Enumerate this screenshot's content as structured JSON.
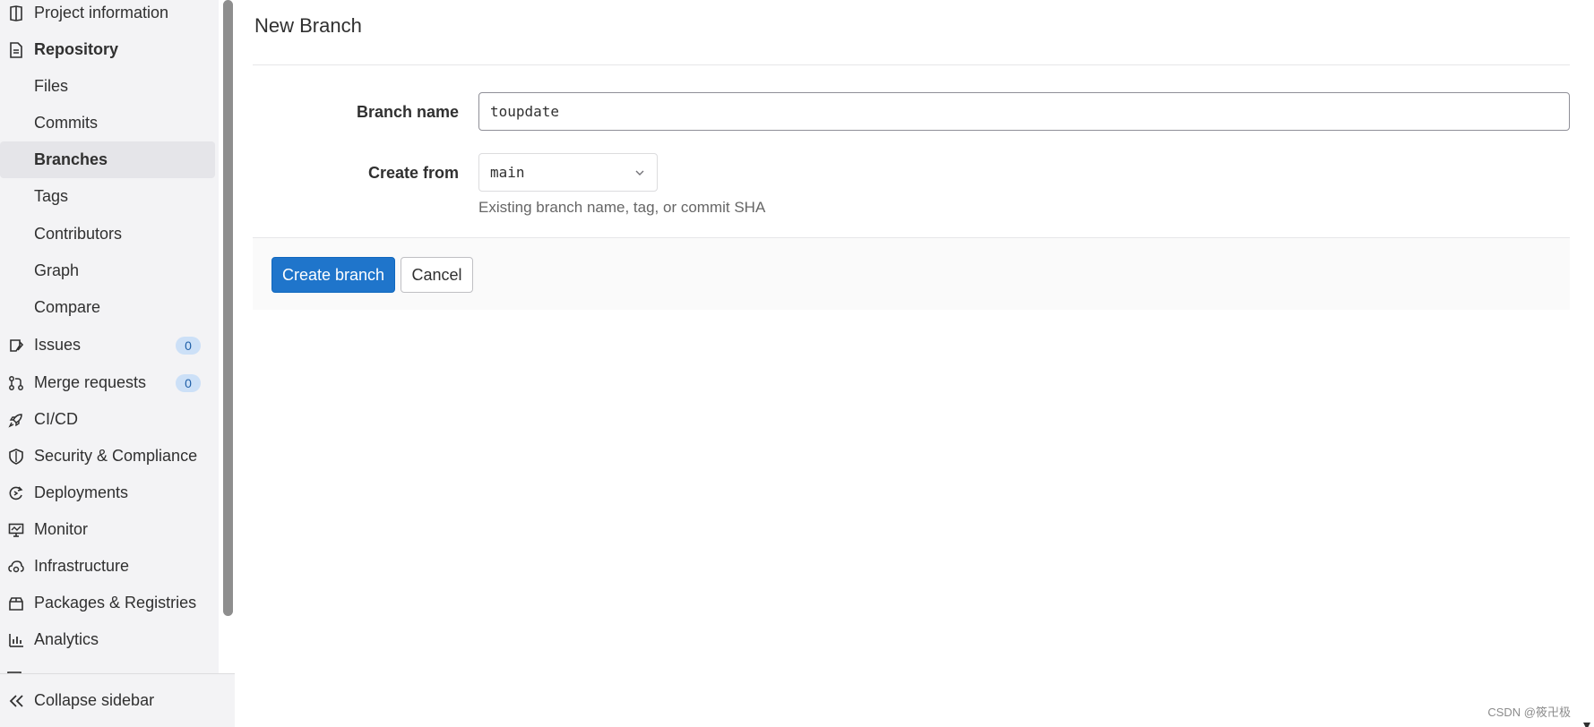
{
  "sidebar": {
    "items": [
      {
        "label": "Project information",
        "kind": "section-plain",
        "icon": "info-icon"
      },
      {
        "label": "Repository",
        "kind": "section",
        "icon": "document-icon"
      },
      {
        "label": "Files",
        "kind": "sub"
      },
      {
        "label": "Commits",
        "kind": "sub"
      },
      {
        "label": "Branches",
        "kind": "sub-active"
      },
      {
        "label": "Tags",
        "kind": "sub"
      },
      {
        "label": "Contributors",
        "kind": "sub"
      },
      {
        "label": "Graph",
        "kind": "sub"
      },
      {
        "label": "Compare",
        "kind": "sub"
      },
      {
        "label": "Issues",
        "kind": "top",
        "icon": "issues-icon",
        "badge": "0"
      },
      {
        "label": "Merge requests",
        "kind": "top",
        "icon": "merge-request-icon",
        "badge": "0"
      },
      {
        "label": "CI/CD",
        "kind": "top",
        "icon": "rocket-icon"
      },
      {
        "label": "Security & Compliance",
        "kind": "top",
        "icon": "shield-icon"
      },
      {
        "label": "Deployments",
        "kind": "top",
        "icon": "deployments-icon"
      },
      {
        "label": "Monitor",
        "kind": "top",
        "icon": "monitor-icon"
      },
      {
        "label": "Infrastructure",
        "kind": "top",
        "icon": "cloud-gear-icon"
      },
      {
        "label": "Packages & Registries",
        "kind": "top",
        "icon": "package-icon"
      },
      {
        "label": "Analytics",
        "kind": "top",
        "icon": "chart-icon"
      }
    ],
    "collapse_label": "Collapse sidebar"
  },
  "main": {
    "title": "New Branch",
    "branch_name_label": "Branch name",
    "branch_name_value": "toupdate",
    "create_from_label": "Create from",
    "create_from_value": "main",
    "help_text": "Existing branch name, tag, or commit SHA",
    "create_button": "Create branch",
    "cancel_button": "Cancel"
  },
  "watermark": "CSDN @筱卍极",
  "colors": {
    "primary": "#1f75cb",
    "sidebar_bg": "#f3f3f5",
    "badge_bg": "#cce0f7"
  }
}
